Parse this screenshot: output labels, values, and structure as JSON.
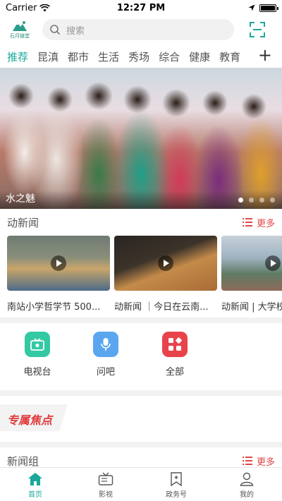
{
  "status_bar": {
    "carrier": "Carrier",
    "time": "12:27 PM"
  },
  "header": {
    "logo_text": "石月链堂",
    "search_placeholder": "搜索"
  },
  "tabs": [
    {
      "label": "推荐",
      "active": true
    },
    {
      "label": "昆滇"
    },
    {
      "label": "都市"
    },
    {
      "label": "生活"
    },
    {
      "label": "秀场"
    },
    {
      "label": "综合"
    },
    {
      "label": "健康"
    },
    {
      "label": "教育"
    }
  ],
  "banner": {
    "caption": "水之魅",
    "slide_count": 4,
    "active_slide": 1
  },
  "news_section": {
    "title": "动新闻",
    "more_label": "更多",
    "videos": [
      {
        "title": "南站小学哲学节 500..."
      },
      {
        "title": "动新闻 ｜今日在云南..."
      },
      {
        "title": "动新闻 | 大学校"
      }
    ]
  },
  "quick_links": [
    {
      "label": "电视台",
      "icon": "tv-icon",
      "color": "#33c9a4"
    },
    {
      "label": "问吧",
      "icon": "microphone-icon",
      "color": "#5aa7f0"
    },
    {
      "label": "全部",
      "icon": "grid-icon",
      "color": "#e8434a"
    }
  ],
  "special_focus": {
    "title": "专属焦点"
  },
  "group_section": {
    "title": "新闻组",
    "more_label": "更多"
  },
  "bottom_nav": [
    {
      "label": "首页",
      "icon": "home-icon",
      "active": true
    },
    {
      "label": "影视",
      "icon": "tv-icon"
    },
    {
      "label": "政务号",
      "icon": "bookmark-icon"
    },
    {
      "label": "我的",
      "icon": "user-icon"
    }
  ],
  "colors": {
    "accent": "#1aa89a",
    "more": "#e04848",
    "special": "#e03a3a"
  }
}
